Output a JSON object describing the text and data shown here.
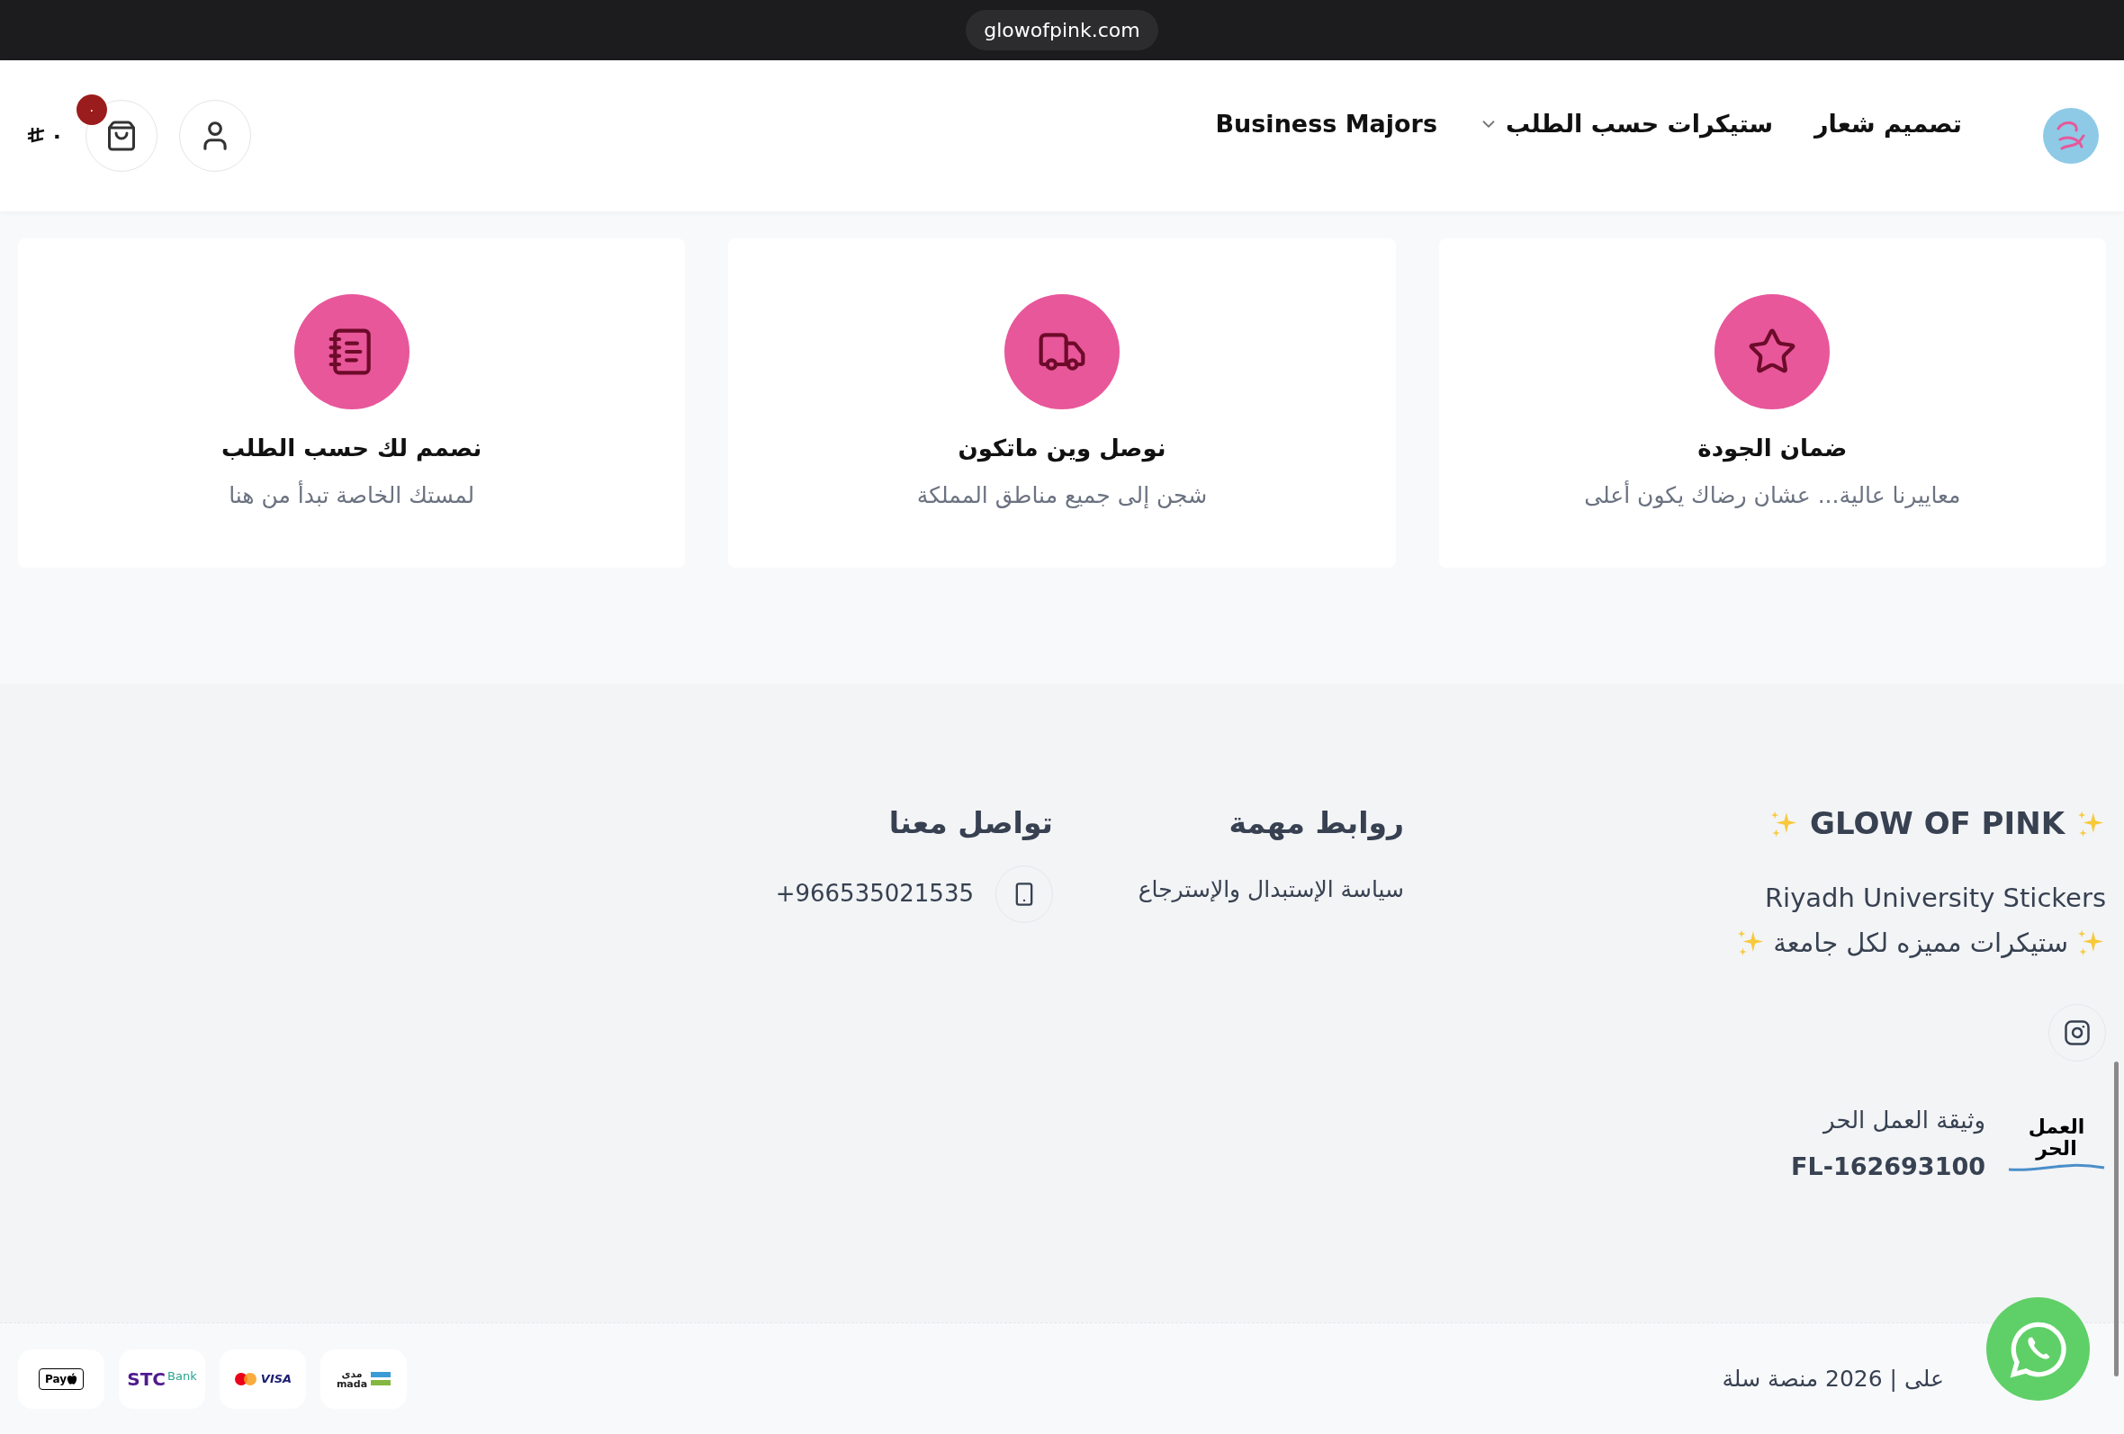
{
  "browser_bar": {
    "url": "glowofpink.com"
  },
  "header": {
    "nav": [
      {
        "label": "تصميم شعار",
        "has_dropdown": false
      },
      {
        "label": "ستيكرات حسب الطلب",
        "has_dropdown": true
      },
      {
        "label": "Business Majors",
        "has_dropdown": false
      }
    ],
    "cart_badge": "٠",
    "cart_total": "٠"
  },
  "features": [
    {
      "title": "ضمان الجودة",
      "subtitle": "معاييرنا عالية... عشان رضاك يكون أعلى"
    },
    {
      "title": "نوصل وين ماتكون",
      "subtitle": "شجن إلى جميع مناطق المملكة"
    },
    {
      "title": "نصمم لك حسب الطلب",
      "subtitle": "لمستك الخاصة تبدأ من هنا"
    }
  ],
  "footer": {
    "brand": {
      "title": "GLOW OF PINK",
      "lines": [
        "Riyadh University Stickers",
        "ستيكرات مميزه لكل جامعة"
      ]
    },
    "freelance": {
      "logo_text": [
        "العمل",
        "الحر"
      ],
      "label": "وثيقة العمل الحر",
      "number": "FL-162693100"
    },
    "links": {
      "title": "روابط مهمة",
      "items": [
        "سياسة الإستبدال والإسترجاع"
      ]
    },
    "contact": {
      "title": "تواصل معنا",
      "phone": "+966535021535"
    },
    "copyright": "على | 2026 منصة سلة",
    "payment_methods": [
      {
        "kind": "mada",
        "parts": [
          "مدى",
          "mada"
        ]
      },
      {
        "kind": "card",
        "parts": [
          "VISA"
        ]
      },
      {
        "kind": "stc",
        "parts": [
          "Bank",
          "STC"
        ]
      },
      {
        "kind": "applepay",
        "parts": [
          "Pay"
        ]
      }
    ]
  }
}
